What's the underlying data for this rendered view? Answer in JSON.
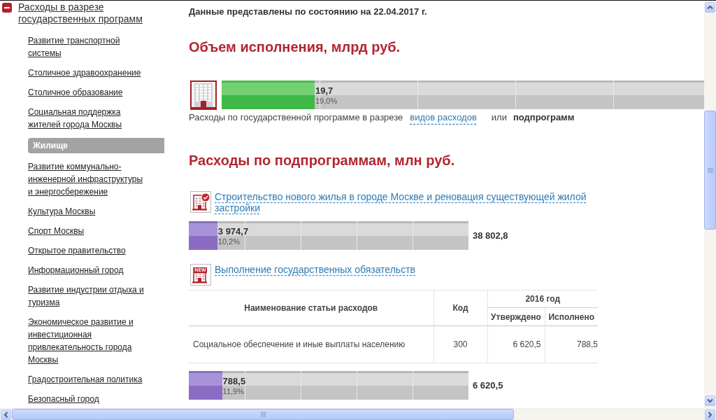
{
  "sidebar": {
    "section": {
      "label": "Расходы в разрезе государственных программ",
      "expanded": true
    },
    "items": [
      {
        "label": "Развитие транспортной системы",
        "selected": false
      },
      {
        "label": "Столичное здравоохранение",
        "selected": false
      },
      {
        "label": "Столичное образование",
        "selected": false
      },
      {
        "label": "Социальная поддержка жителей города Москвы",
        "selected": false
      },
      {
        "label": "Жилище",
        "selected": true
      },
      {
        "label": "Развитие коммунально-инженерной инфраструктуры и энергосбережение",
        "selected": false
      },
      {
        "label": "Культура Москвы",
        "selected": false
      },
      {
        "label": "Спорт Москвы",
        "selected": false
      },
      {
        "label": "Открытое правительство",
        "selected": false
      },
      {
        "label": "Информационный город",
        "selected": false
      },
      {
        "label": "Развитие индустрии отдыха и туризма",
        "selected": false
      },
      {
        "label": "Экономическое развитие и инвестиционная привлекательность города Москвы",
        "selected": false
      },
      {
        "label": "Градостроительная политика",
        "selected": false
      },
      {
        "label": "Безопасный город",
        "selected": false
      }
    ]
  },
  "content": {
    "data_date": "Данные представлены по состоянию на 22.04.2017 г.",
    "execution": {
      "title": "Объем исполнения, млрд руб.",
      "bar": {
        "level": 0.19,
        "value": "19,7",
        "percent": "19,0%"
      }
    },
    "breakdown": {
      "label": "Расходы по государственной программе в разрезе",
      "separator": "или",
      "options": [
        {
          "label": "видов расходов",
          "selected": false
        },
        {
          "label": "подпрограмм",
          "selected": true
        }
      ]
    },
    "subprograms": {
      "title": "Расходы по подпрограммам, млн руб.",
      "items": [
        {
          "kind": "checked",
          "title": "Строительство нового жилья в городе Москве и реновация существующей жилой застройки",
          "bar": {
            "level": 0.102,
            "value": "3 974,7",
            "percent": "10,2%",
            "total": "38 802,8"
          }
        },
        {
          "kind": "new",
          "badge": "NEW",
          "title": "Выполнение государственных обязательств",
          "table": {
            "header": {
              "name": "Наименование статьи расходов",
              "code": "Код",
              "period": "2016 год",
              "approved": "Утверждено",
              "executed": "Исполнено"
            },
            "rows": [
              {
                "name": "Социальное обеспечение и иные выплаты населению",
                "code": "300",
                "approved": "6 620,5",
                "executed": "788,5"
              }
            ]
          },
          "bar": {
            "level": 0.119,
            "value": "788,5",
            "percent": "11,9%",
            "total": "6 620,5"
          }
        }
      ]
    }
  }
}
